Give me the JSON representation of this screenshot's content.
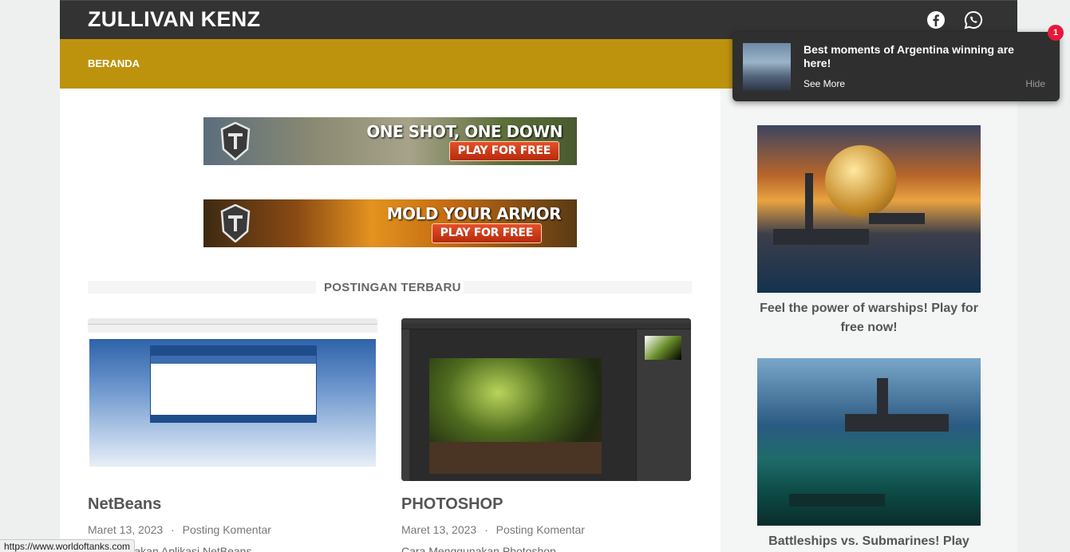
{
  "header": {
    "site_title": "ZULLIVAN KENZ",
    "icons": [
      "facebook-icon",
      "whatsapp-icon"
    ]
  },
  "nav": {
    "items": [
      {
        "label": "BERANDA"
      }
    ]
  },
  "banners": [
    {
      "headline": "ONE SHOT, ONE DOWN",
      "button": "PLAY FOR FREE"
    },
    {
      "headline": "MOLD YOUR ARMOR",
      "button": "PLAY FOR FREE"
    }
  ],
  "section": {
    "title": "POSTINGAN TERBARU"
  },
  "posts": [
    {
      "title": "NetBeans",
      "date": "Maret 13, 2023",
      "separator": "·",
      "comment": "Posting Komentar",
      "excerpt": "Menggunakan Aplikasi NetBeans"
    },
    {
      "title": "PHOTOSHOP",
      "date": "Maret 13, 2023",
      "separator": "·",
      "comment": "Posting Komentar",
      "excerpt": "Cara Menggunakan Photoshop"
    }
  ],
  "sidebar": {
    "cards": [
      {
        "caption": "Feel the power of warships! Play for free now!"
      },
      {
        "caption": "Battleships vs. Submarines! Play"
      }
    ]
  },
  "notification": {
    "title": "Best moments of Argentina winning are here!",
    "see_more": "See More",
    "hide": "Hide",
    "badge": "1"
  },
  "status_bar": {
    "url": "https://www.worldoftanks.com"
  },
  "colors": {
    "topbar": "#333333",
    "navbar": "#bd930e",
    "badge": "#e8173a"
  }
}
